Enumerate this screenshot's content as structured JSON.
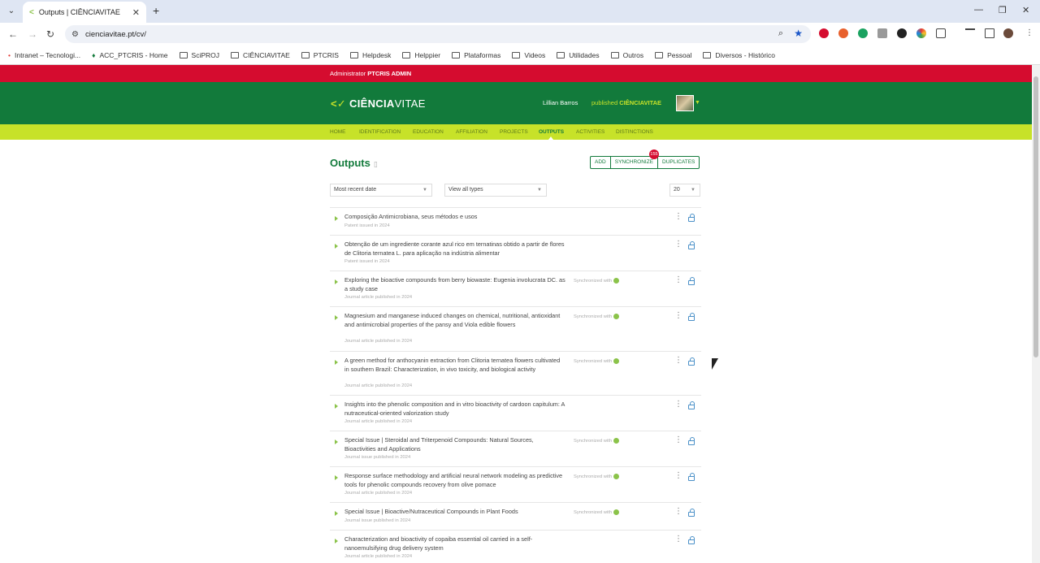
{
  "browser": {
    "tab_title": "Outputs | CIÊNCIAVITAE",
    "url": "cienciavitae.pt/cv/",
    "bookmarks": [
      "Intranet – Tecnologi...",
      "ACC_PTCRIS - Home",
      "SciPROJ",
      "CIÊNCIAVITAE",
      "PTCRIS",
      "Helpdesk",
      "Helppier",
      "Plataformas",
      "Videos",
      "Utilidades",
      "Outros",
      "Pessoal",
      "Diversos - Histórico"
    ]
  },
  "admin_bar": {
    "prefix": "Administrator",
    "name": "PTCRIS ADMIN"
  },
  "header": {
    "logo_main": "CIÊNCIA",
    "logo_sub": "VITAE",
    "user_name": "Lillian Barros",
    "published_label": "published",
    "published_brand": "CIÊNCIAVITAE"
  },
  "nav": [
    "HOME",
    "IDENTIFICATION",
    "EDUCATION",
    "AFFILIATION",
    "PROJECTS",
    "OUTPUTS",
    "ACTIVITIES",
    "DISTINCTIONS"
  ],
  "main": {
    "title": "Outputs",
    "buttons": {
      "add": "ADD",
      "synchronize": "SYNCHRONIZE",
      "duplicates": "DUPLICATES"
    },
    "sync_count": "155",
    "sort_value": "Most recent date",
    "type_value": "View all types",
    "page_size": "20",
    "sync_text": "Synchronized with",
    "items": [
      {
        "title": "Composição Antimicrobiana, seus métodos e usos",
        "meta": "Patent issued in 2024"
      },
      {
        "title": "Obtenção de um ingrediente corante azul rico em ternatinas obtido a partir de flores de Clitoria ternatea L. para aplicação na indústria alimentar",
        "meta": "Patent issued in 2024"
      },
      {
        "title": "Exploring the bioactive compounds from berry biowaste: Eugenia involucrata DC. as a study case",
        "meta": "Journal article published in 2024"
      },
      {
        "title": "Magnesium and manganese induced changes on chemical, nutritional, antioxidant and antimicrobial properties of the pansy and Viola edible flowers",
        "meta": "Journal article published in 2024"
      },
      {
        "title": "A green method for anthocyanin extraction from Clitoria ternatea flowers cultivated in southern Brazil: Characterization, in vivo toxicity, and biological activity",
        "meta": "Journal article published in 2024"
      },
      {
        "title": "Insights into the phenolic composition and in vitro bioactivity of cardoon capitulum: A nutraceutical-oriented valorization study",
        "meta": "Journal article published in 2024"
      },
      {
        "title": "Special Issue | Steroidal and Triterpenoid Compounds: Natural Sources, Bioactivities and Applications",
        "meta": "Journal issue published in 2024"
      },
      {
        "title": "Response surface methodology and artificial neural network modeling as predictive tools for phenolic compounds recovery from olive pomace",
        "meta": "Journal article published in 2024"
      },
      {
        "title": "Special Issue | Bioactive/Nutraceutical Compounds in Plant Foods",
        "meta": "Journal issue published in 2024"
      },
      {
        "title": "Characterization and bioactivity of copaiba essential oil carried in a self-nanoemulsifying drug delivery system",
        "meta": "Journal article published in 2024"
      }
    ]
  }
}
